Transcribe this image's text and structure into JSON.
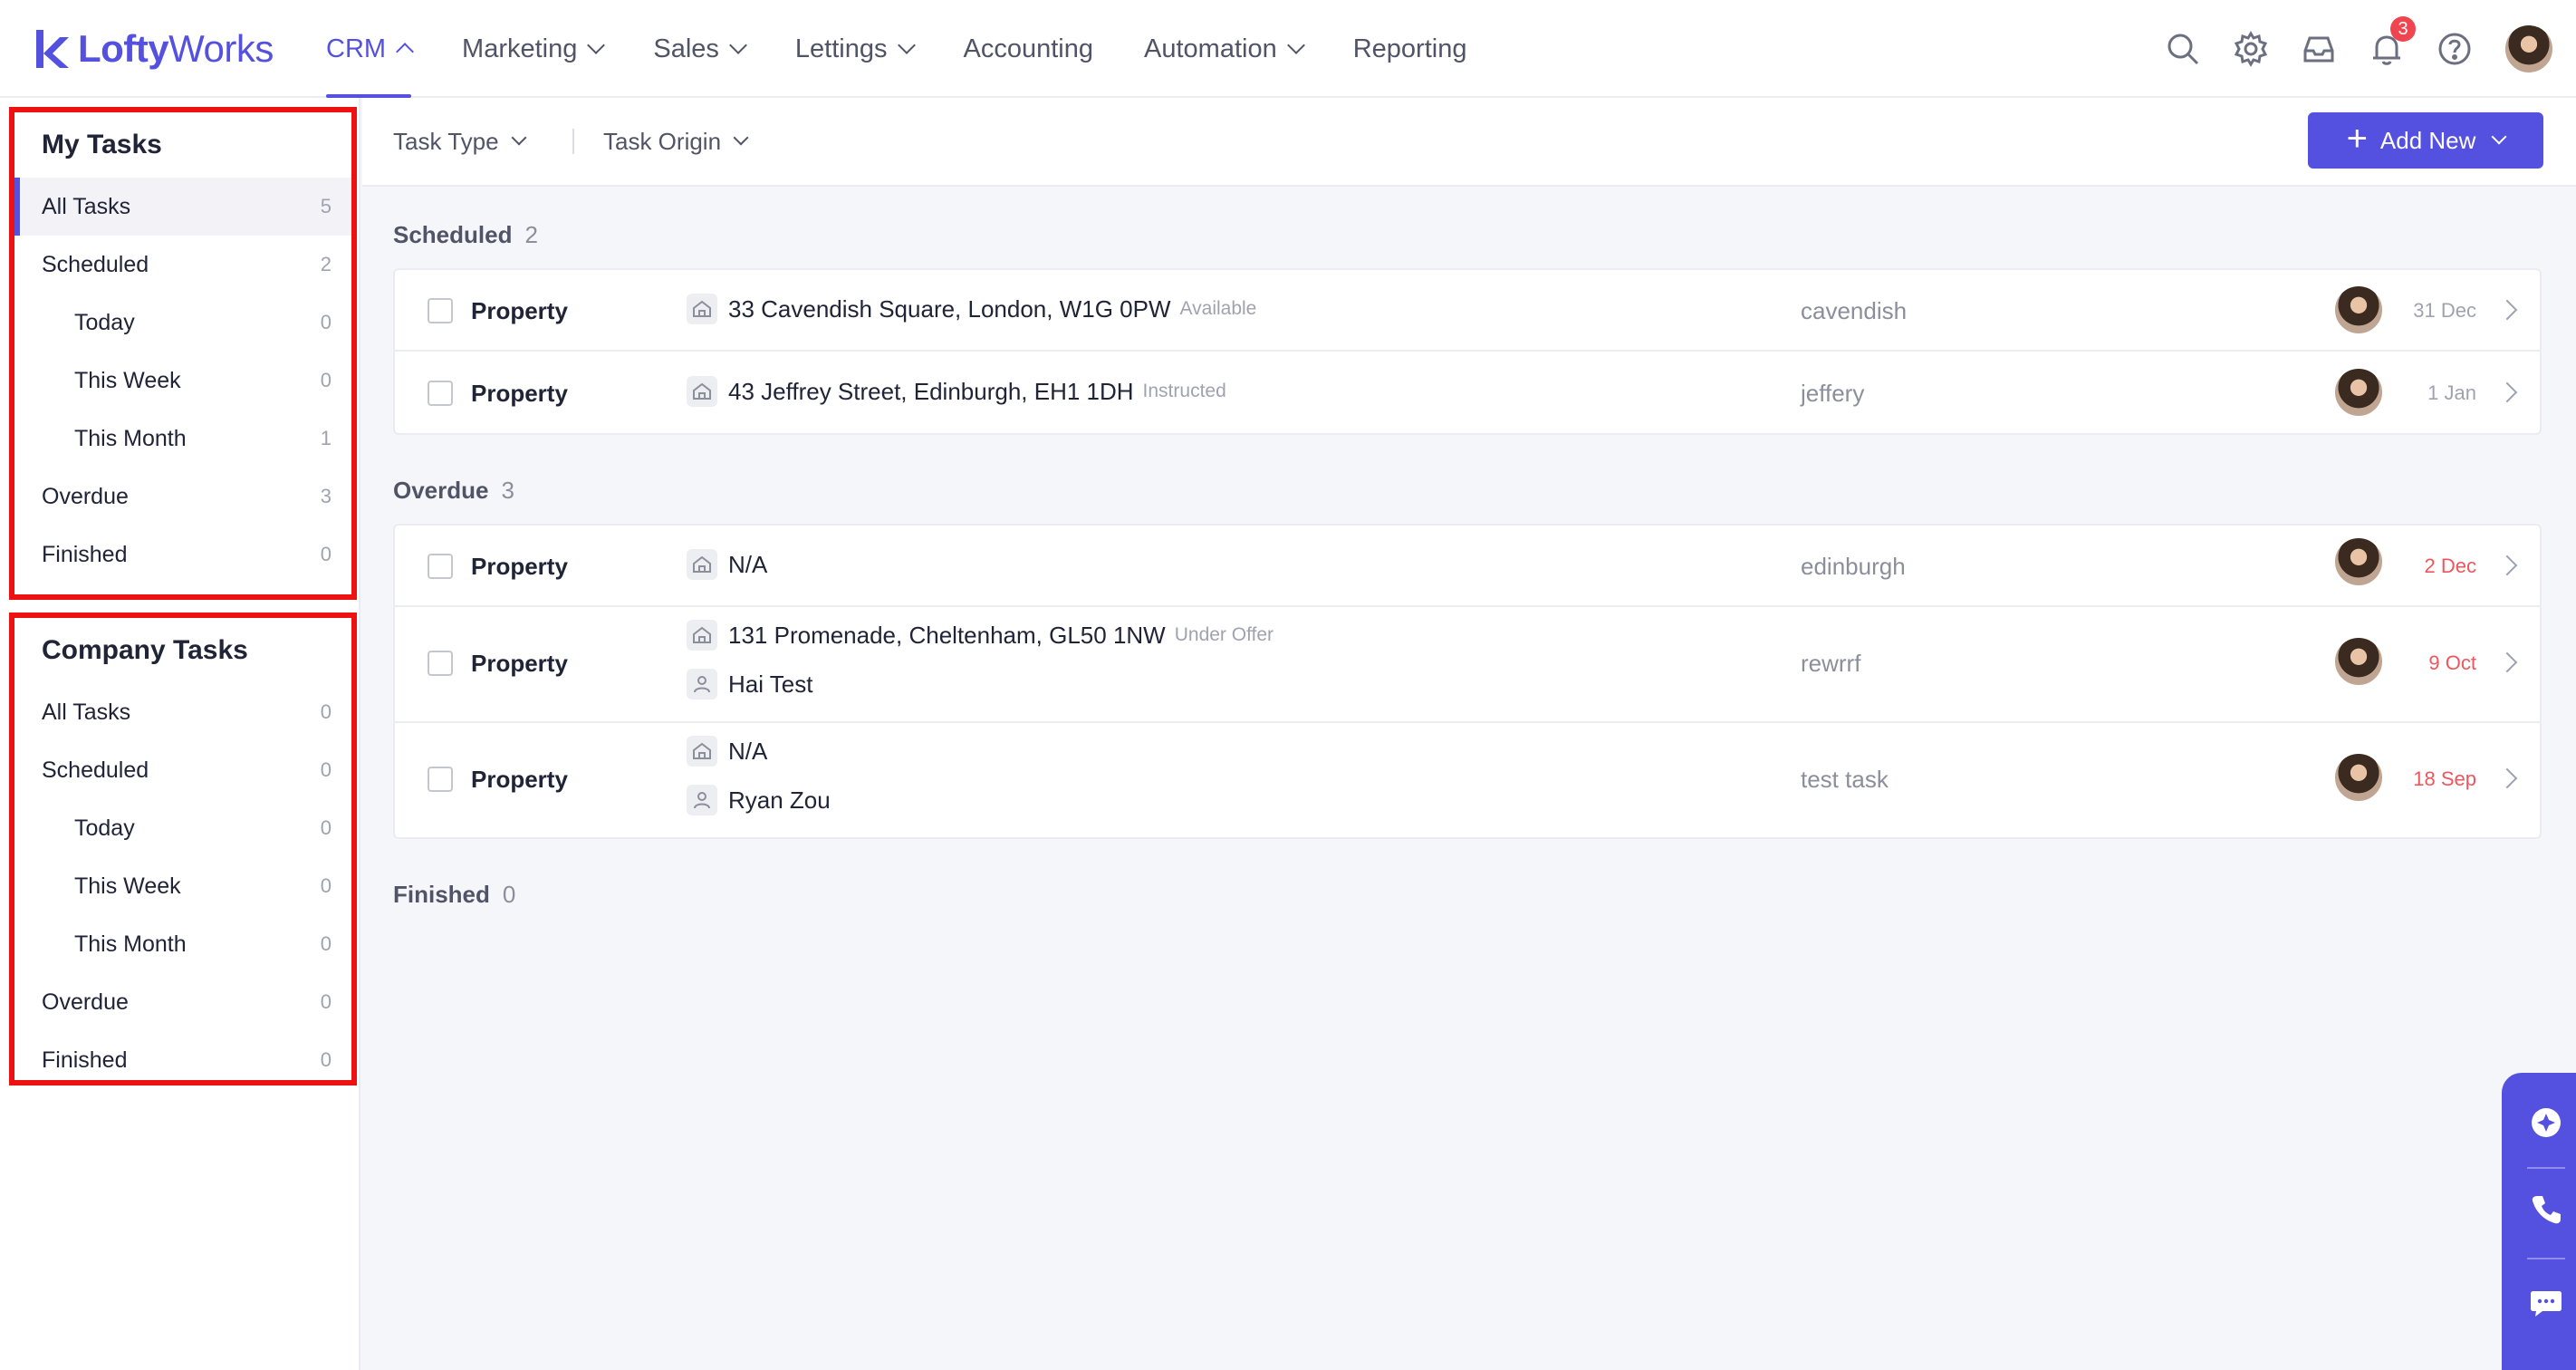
{
  "brand": {
    "logo_bold": "Lofty",
    "logo_light": "Works",
    "accent": "#5551e0"
  },
  "nav": {
    "items": [
      {
        "label": "CRM",
        "active": true,
        "has_menu": true
      },
      {
        "label": "Marketing",
        "has_menu": true
      },
      {
        "label": "Sales",
        "has_menu": true
      },
      {
        "label": "Lettings",
        "has_menu": true
      },
      {
        "label": "Accounting",
        "has_menu": false
      },
      {
        "label": "Automation",
        "has_menu": true
      },
      {
        "label": "Reporting",
        "has_menu": false
      }
    ],
    "notification_count": "3",
    "icons": [
      "search-icon",
      "gear-icon",
      "inbox-icon",
      "bell-icon",
      "help-icon"
    ]
  },
  "sidebar": {
    "my_tasks": {
      "title": "My Tasks",
      "items": [
        {
          "label": "All Tasks",
          "count": "5"
        },
        {
          "label": "Scheduled",
          "count": "2"
        },
        {
          "label": "Today",
          "count": "0"
        },
        {
          "label": "This Week",
          "count": "0"
        },
        {
          "label": "This Month",
          "count": "1"
        },
        {
          "label": "Overdue",
          "count": "3"
        },
        {
          "label": "Finished",
          "count": "0"
        }
      ]
    },
    "company_tasks": {
      "title": "Company Tasks",
      "items": [
        {
          "label": "All Tasks",
          "count": "0"
        },
        {
          "label": "Scheduled",
          "count": "0"
        },
        {
          "label": "Today",
          "count": "0"
        },
        {
          "label": "This Week",
          "count": "0"
        },
        {
          "label": "This Month",
          "count": "0"
        },
        {
          "label": "Overdue",
          "count": "0"
        },
        {
          "label": "Finished",
          "count": "0"
        }
      ]
    }
  },
  "filters": {
    "task_type": "Task Type",
    "task_origin": "Task Origin"
  },
  "add_new": {
    "label": "Add New"
  },
  "sections": {
    "scheduled": {
      "label": "Scheduled",
      "count": "2",
      "rows": [
        {
          "type": "Property",
          "address": "33 Cavendish Square, London, W1G 0PW",
          "status": "Available",
          "name": "cavendish",
          "date": "31 Dec"
        },
        {
          "type": "Property",
          "address": "43 Jeffrey Street, Edinburgh, EH1 1DH",
          "status": "Instructed",
          "name": "jeffery",
          "date": "1 Jan"
        }
      ]
    },
    "overdue": {
      "label": "Overdue",
      "count": "3",
      "rows": [
        {
          "type": "Property",
          "address": "N/A",
          "name": "edinburgh",
          "date": "2 Dec"
        },
        {
          "type": "Property",
          "address": "131 Promenade, Cheltenham, GL50 1NW",
          "status": "Under Offer",
          "contact": "Hai Test",
          "name": "rewrrf",
          "date": "9 Oct"
        },
        {
          "type": "Property",
          "address": "N/A",
          "contact": "Ryan Zou",
          "name": "test task",
          "date": "18 Sep"
        }
      ]
    },
    "finished": {
      "label": "Finished",
      "count": "0"
    }
  },
  "colors": {
    "overdue_date": "#f0555d",
    "highlight_border": "#ee1111"
  }
}
